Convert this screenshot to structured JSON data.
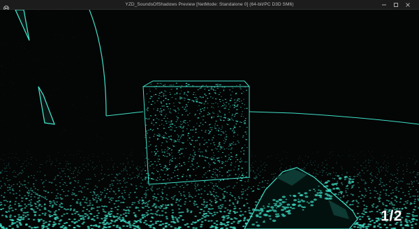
{
  "window": {
    "title": "YZD_SoundsOfShadows Preview [NetMode: Standalone 0]  (64-bit/PC D3D SM6)",
    "controls": {
      "minimize_icon": "minimize-icon",
      "maximize_icon": "maximize-icon",
      "close_icon": "close-icon"
    }
  },
  "hud": {
    "ammo": "1/2"
  },
  "colors": {
    "accent": "#3fe0c8",
    "background": "#040505",
    "titlebar": "#1c1c1c",
    "hud_text": "#ffffff"
  }
}
